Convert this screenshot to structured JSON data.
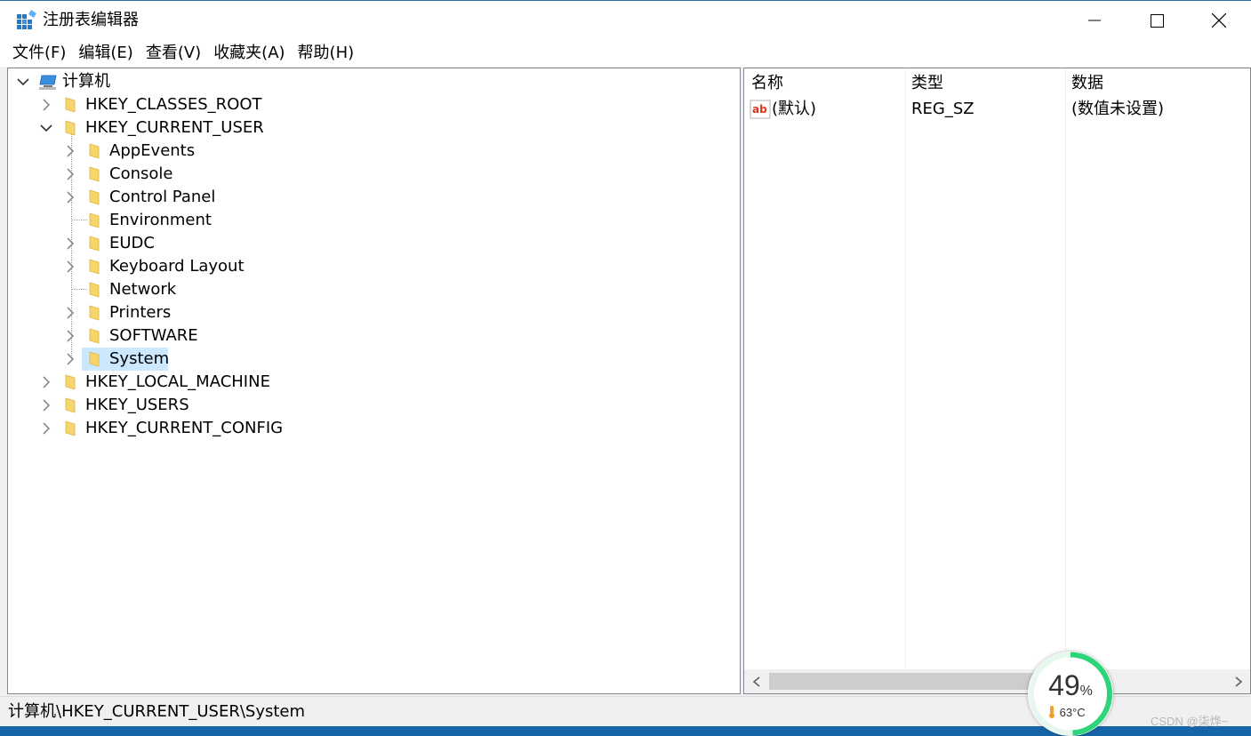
{
  "window": {
    "title": "注册表编辑器"
  },
  "menu": [
    "文件(F)",
    "编辑(E)",
    "查看(V)",
    "收藏夹(A)",
    "帮助(H)"
  ],
  "tree": {
    "root": "计算机",
    "hives": {
      "classes_root": "HKEY_CLASSES_ROOT",
      "current_user": "HKEY_CURRENT_USER",
      "local_machine": "HKEY_LOCAL_MACHINE",
      "users": "HKEY_USERS",
      "current_config": "HKEY_CURRENT_CONFIG"
    },
    "current_user_children": [
      "AppEvents",
      "Console",
      "Control Panel",
      "Environment",
      "EUDC",
      "Keyboard Layout",
      "Network",
      "Printers",
      "SOFTWARE",
      "System"
    ],
    "selected": "System"
  },
  "list": {
    "headers": {
      "name": "名称",
      "type": "类型",
      "data": "数据"
    },
    "rows": [
      {
        "name": "(默认)",
        "type": "REG_SZ",
        "data": "(数值未设置)"
      }
    ]
  },
  "status": {
    "path": "计算机\\HKEY_CURRENT_USER\\System"
  },
  "widget": {
    "percent": "49",
    "percent_sign": "%",
    "temp": "63°C",
    "percent_value": 0.49
  },
  "watermark": "CSDN @柒烨~",
  "colors": {
    "selection": "#cce8ff",
    "folder": "#f5d56c",
    "widget_ring": "#2ed47a",
    "desktop": "#1565a8"
  }
}
